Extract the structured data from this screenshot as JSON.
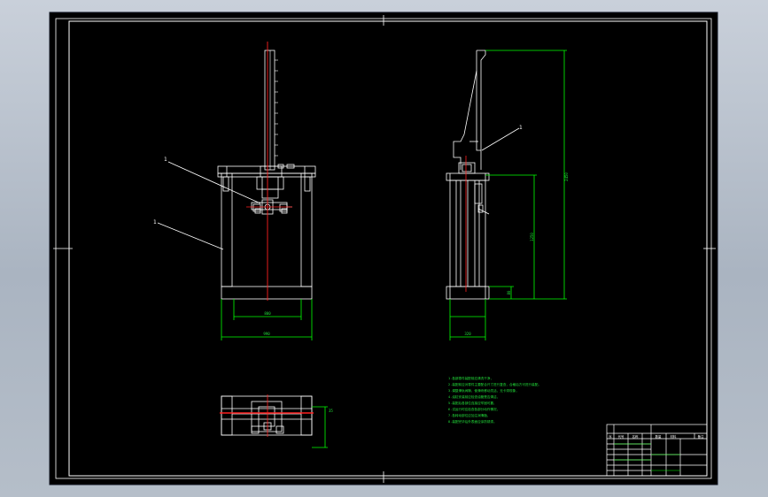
{
  "drawing": {
    "background_color": "#000000",
    "frame_color": "#ffffff",
    "geometry_color": "#ffffff",
    "dimension_color": "#00ff00",
    "centerline_color": "#ff2020",
    "leader_color": "#ffffff"
  },
  "front_view": {
    "part_leader_1": "1",
    "part_leader_2": "1"
  },
  "side_view": {
    "part_leader_1": "1"
  },
  "dimensions": {
    "front_inner_width": "800",
    "front_outer_width": "990",
    "side_overall_height": "2450",
    "side_cylinder_height": "1250",
    "side_base_height": "80",
    "side_base_width": "320",
    "top_view_depth": "35"
  },
  "technical_notes": [
    "1.各部零件装配前应清洗干净，",
    "2.装配前应对零件主要配合尺寸进行复查，合格后方可进行装配。",
    "3.调整滑轨间隙，使滑块移动灵活，无卡滞现象，",
    "4.油缸安装前应检查油管是否清洁，",
    "5.装配后各部位连接应牢固可靠，",
    "6.试运行时应检查各部分动作情况，",
    "7.各转动部位应加注润滑脂，",
    "8.装配完毕后外表面应涂防锈漆。"
  ],
  "title_block": {
    "header_labels": [
      "序",
      "代号",
      "名称",
      "数量",
      "材料",
      "备注"
    ]
  }
}
